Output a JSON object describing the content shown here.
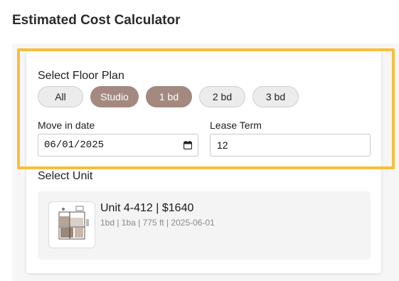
{
  "page_title": "Estimated Cost Calculator",
  "floor_plan": {
    "label": "Select Floor Plan",
    "options": [
      "All",
      "Studio",
      "1 bd",
      "2 bd",
      "3 bd"
    ],
    "selected": [
      "Studio",
      "1 bd"
    ]
  },
  "move_in": {
    "label": "Move in date",
    "value": "06/01/2025"
  },
  "lease_term": {
    "label": "Lease Term",
    "value": "12"
  },
  "unit": {
    "label": "Select Unit",
    "title": "Unit 4-412 | $1640",
    "details": "1bd | 1ba | 775 ft | 2025-06-01",
    "thumbnail_icon": "floor-plan-thumbnail-icon"
  },
  "colors": {
    "highlight_border": "#f6bf3d",
    "chip_selected": "#a48980",
    "chip_default": "#ececec"
  }
}
